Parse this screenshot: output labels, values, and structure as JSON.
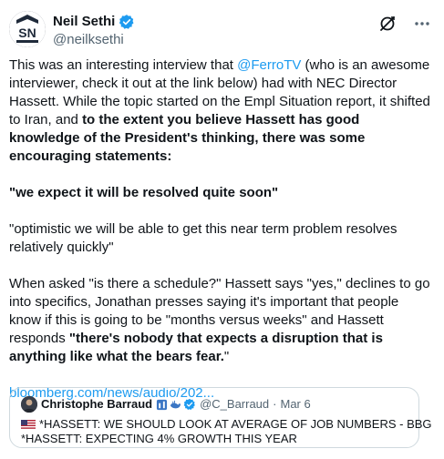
{
  "author": {
    "display_name": "Neil Sethi",
    "handle": "@neilksethi"
  },
  "tweet": {
    "p1_a": "This was an interesting interview that ",
    "p1_mention": "@FerroTV",
    "p1_b": " (who is an awesome interviewer, check it out at the link below) had with NEC Director Hassett.  While the topic started on the Empl Situation report, it shifted to Iran, and ",
    "p1_bold": "to the extent you believe Hassett has good knowledge of the President's thinking, there was some encouraging statements:",
    "p2_bold": "\"we expect it will be resolved quite soon\"",
    "p3": "\"optimistic we will be able to get this near term problem resolves relatively quickly\"",
    "p4_a": "When asked \"is there a schedule?\" Hassett says \"yes,\" declines to go into specifics, Jonathan presses saying it's important that people know if this is going to be \"months versus weeks\" and Hassett responds ",
    "p4_bold": "\"there's nobody that expects a disruption that is anything like what the bears fear.",
    "p4_end": "\"",
    "link": "bloomberg.com/news/audio/202..."
  },
  "quote": {
    "display_name": "Christophe Barraud",
    "handle": "@C_Barraud",
    "separator": "·",
    "date": "Mar 6",
    "line1": "*HASSETT: WE SHOULD LOOK AT AVERAGE OF JOB NUMBERS - BBG",
    "line2": "*HASSETT: EXPECTING 4% GROWTH THIS YEAR"
  },
  "icons": {
    "verified": "verified-badge-icon",
    "grok": "grok-icon",
    "more": "more-icon",
    "flag": "us-flag-icon"
  },
  "colors": {
    "link": "#1d9bf0",
    "verified": "#1d9bf0",
    "text": "#0f1419",
    "muted": "#536471",
    "border": "#cfd9de"
  }
}
